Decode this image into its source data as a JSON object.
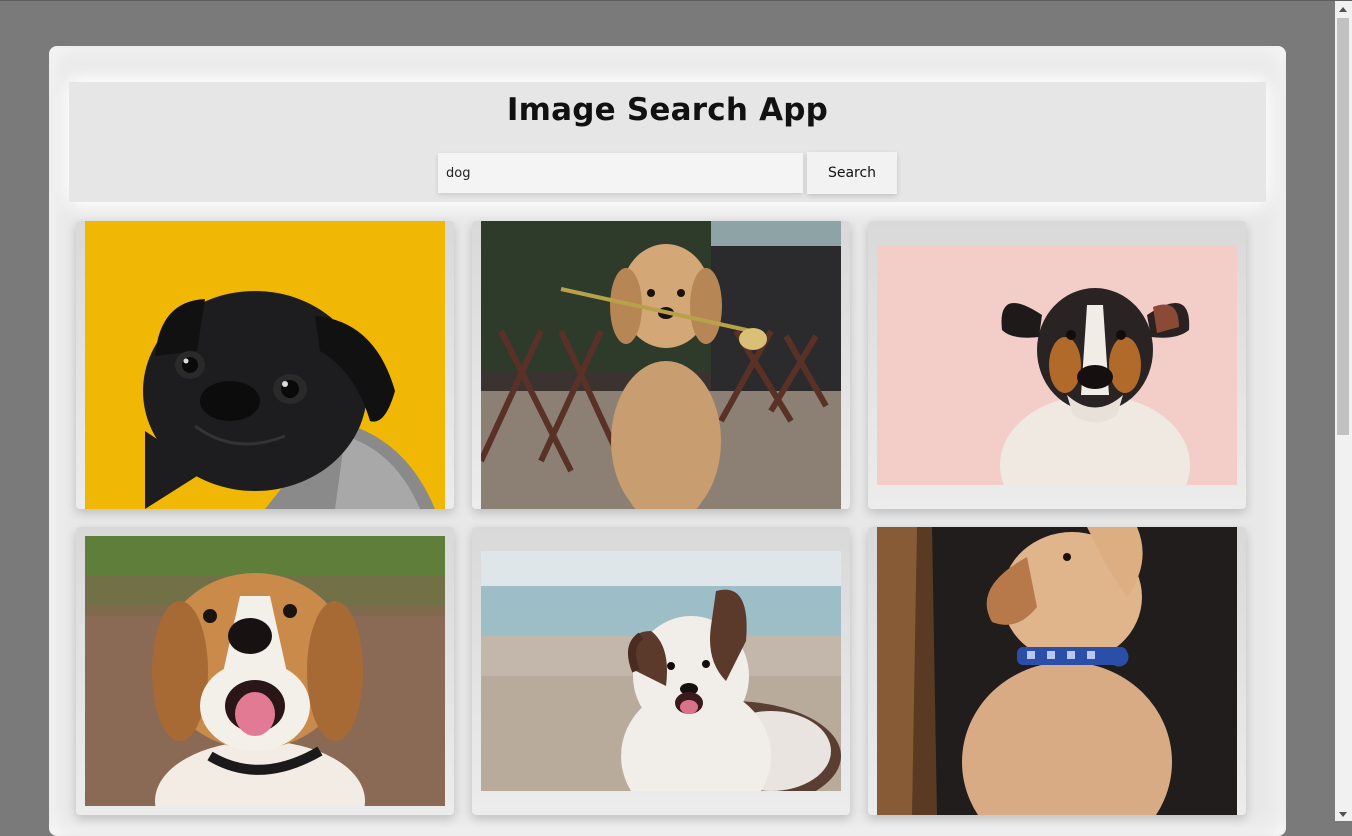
{
  "app": {
    "title": "Image Search App"
  },
  "search": {
    "value": "dog",
    "button_label": "Search"
  },
  "results": [
    {
      "subject": "black pug on yellow background"
    },
    {
      "subject": "golden retriever holding flower"
    },
    {
      "subject": "jack russell terrier on pink background"
    },
    {
      "subject": "beagle smiling outdoors"
    },
    {
      "subject": "australian shepherd on beach"
    },
    {
      "subject": "labrador puppy with blue collar"
    }
  ],
  "colors": {
    "page_background": "#7a7a7a",
    "panel_background": "#e8e8e8",
    "pug_background": "#f0b704",
    "pink_background": "#f3cec8"
  }
}
